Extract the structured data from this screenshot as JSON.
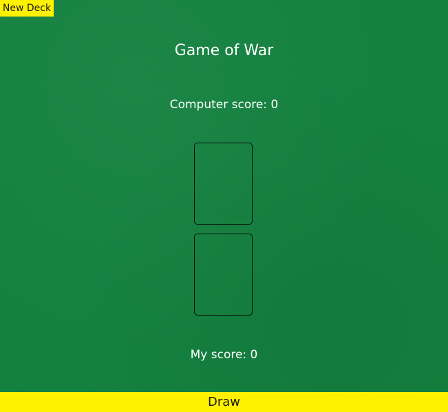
{
  "header": {
    "new_deck_label": "New Deck",
    "title": "Game of War"
  },
  "scores": {
    "computer_label": "Computer score: 0",
    "player_label": "My score: 0"
  },
  "cards": {
    "computer_card": "",
    "player_card": ""
  },
  "controls": {
    "draw_label": "Draw"
  },
  "colors": {
    "table_felt": "#13813f",
    "button_yellow": "#fff200",
    "text": "#ffffff"
  }
}
